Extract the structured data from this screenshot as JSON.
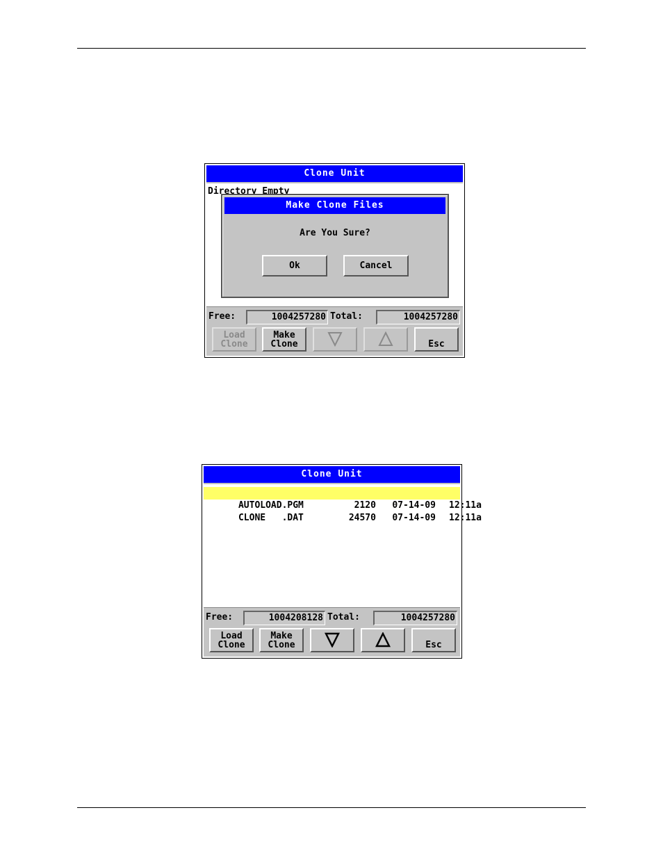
{
  "screen1": {
    "title": "Clone Unit",
    "directory_status": "Directory Empty",
    "dialog": {
      "title": "Make Clone Files",
      "message": "Are You Sure?",
      "ok_label": "Ok",
      "cancel_label": "Cancel"
    },
    "free_label": "Free:",
    "free_value": "1004257280",
    "total_label": "Total:",
    "total_value": "1004257280",
    "buttons": {
      "load_line1": "Load",
      "load_line2": "Clone",
      "make_line1": "Make",
      "make_line2": "Clone",
      "down_icon": "triangle-down-icon",
      "up_icon": "triangle-up-icon",
      "esc": "Esc"
    },
    "load_clone_disabled": true,
    "arrows_disabled": true
  },
  "screen2": {
    "title": "Clone Unit",
    "files": [
      {
        "name": "AUTOLOAD.PGM",
        "size": "2120",
        "date": "07-14-09",
        "time": "12:11a",
        "selected": true
      },
      {
        "name": "CLONE   .DAT",
        "size": "24570",
        "date": "07-14-09",
        "time": "12:11a",
        "selected": false
      }
    ],
    "free_label": "Free:",
    "free_value": "1004208128",
    "total_label": "Total:",
    "total_value": "1004257280",
    "buttons": {
      "load_line1": "Load",
      "load_line2": "Clone",
      "make_line1": "Make",
      "make_line2": "Clone",
      "down_icon": "triangle-down-icon",
      "up_icon": "triangle-up-icon",
      "esc": "Esc"
    }
  },
  "colors": {
    "titlebar": "#0000ff",
    "selection": "#ffff66",
    "panel": "#c4c4c4"
  }
}
